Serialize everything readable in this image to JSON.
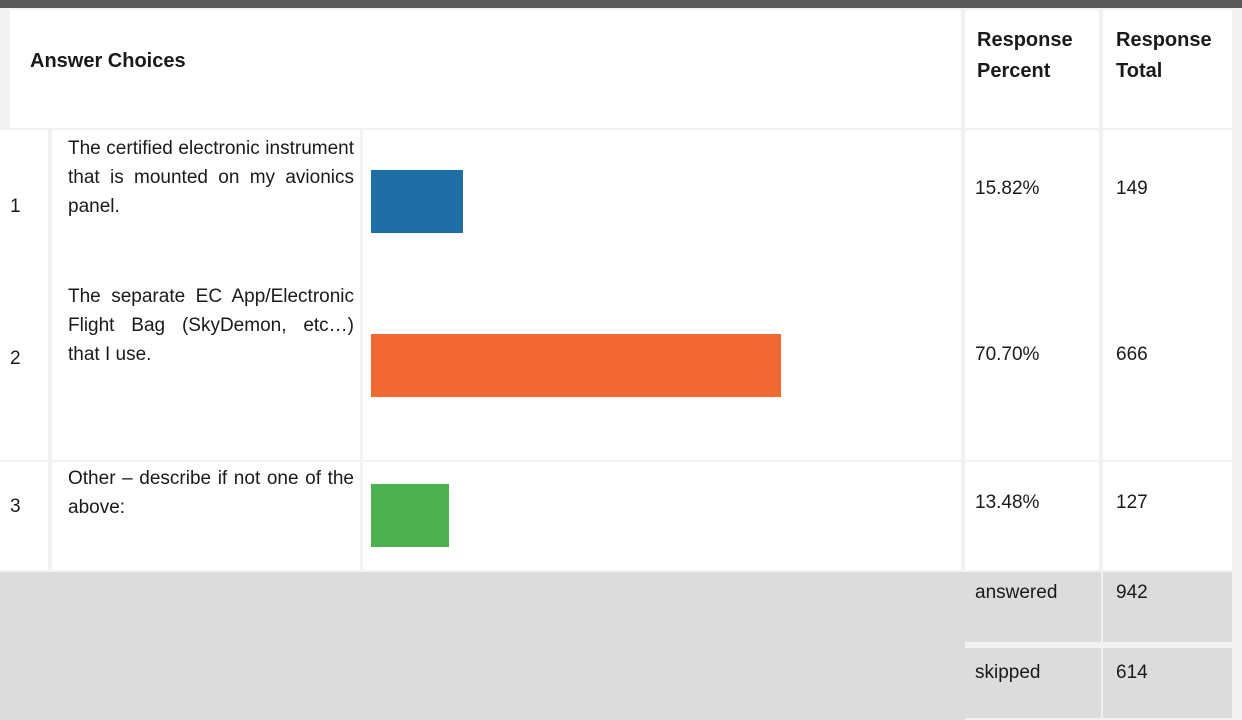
{
  "header": {
    "answer_choices": "Answer Choices",
    "response_percent": "Response Percent",
    "response_total": "Response Total"
  },
  "rows": [
    {
      "num": "1",
      "choice": "The certified electronic instrument that is mounted on my avionics panel.",
      "percent_label": "15.82%",
      "total": "149",
      "color": "#1f6fa6"
    },
    {
      "num": "2",
      "choice": "The separate EC App/Electronic Flight Bag (SkyDemon, etc…) that I use.",
      "percent_label": "70.70%",
      "total": "666",
      "color": "#f26835"
    },
    {
      "num": "3",
      "choice": "Other – describe if not one of the above:",
      "percent_label": "13.48%",
      "total": "127",
      "color": "#4caf50"
    }
  ],
  "summary": {
    "answered_label": "answered",
    "answered_value": "942",
    "skipped_label": "skipped",
    "skipped_value": "614"
  },
  "chart_data": {
    "type": "bar",
    "orientation": "horizontal",
    "categories": [
      "The certified electronic instrument that is mounted on my avionics panel.",
      "The separate EC App/Electronic Flight Bag (SkyDemon, etc…) that I use.",
      "Other – describe if not one of the above:"
    ],
    "values": [
      15.82,
      70.7,
      13.48
    ],
    "totals": [
      149,
      666,
      127
    ],
    "xlim": [
      0,
      100
    ],
    "grid": false,
    "legend": "none"
  }
}
